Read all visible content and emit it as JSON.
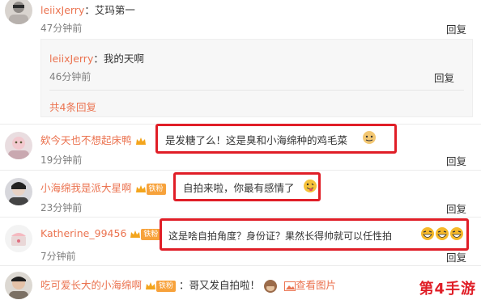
{
  "top_comment": {
    "user": "leiixJerry",
    "colon": "：",
    "text": "艾玛第一",
    "time": "47分钟前",
    "reply": "回复"
  },
  "sub_comment": {
    "user": "leiixJerry",
    "colon": "：",
    "text": "我的天啊",
    "time": "46分钟前",
    "reply": "回复",
    "total_replies": "共4条回复"
  },
  "comments": [
    {
      "user": "欸今天也不想起床鸭",
      "text": "是发糖了么！这是臭和小海绵种的鸡毛菜",
      "time": "19分钟前",
      "reply": "回复"
    },
    {
      "user": "小海绵我是派大星啊",
      "badge": "铁粉",
      "text": "自拍来啦，你最有感情了",
      "time": "23分钟前",
      "reply": "回复"
    },
    {
      "user": "Katherine_99456",
      "badge": "铁粉",
      "text": "这是啥自拍角度？身份证？果然长得帅就可以任性拍",
      "time": "7分钟前",
      "reply": "回复"
    },
    {
      "user": "吃可爱长大的小海绵啊",
      "badge": "铁粉",
      "text": "哥又发自拍啦！",
      "extra": "查看图片"
    }
  ],
  "watermark": {
    "prefix": "第",
    "num": "4",
    "suffix": "手游"
  },
  "colors": {
    "username": "#eb7350",
    "highlight_box": "#e01e27",
    "badge": "#f7a23b"
  }
}
